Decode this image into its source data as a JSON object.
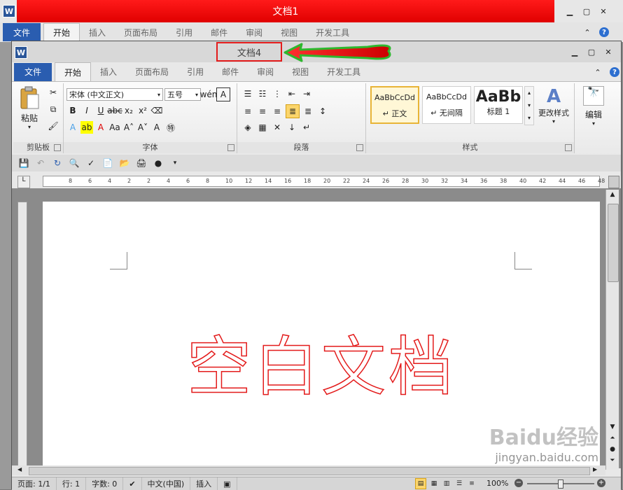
{
  "back_window": {
    "title": "文档1",
    "logo": "W",
    "tabs": [
      "文件",
      "开始",
      "插入",
      "页面布局",
      "引用",
      "邮件",
      "审阅",
      "视图",
      "开发工具"
    ]
  },
  "front_window": {
    "title": "文档4",
    "logo": "W",
    "tabs": [
      "文件",
      "开始",
      "插入",
      "页面布局",
      "引用",
      "邮件",
      "审阅",
      "视图",
      "开发工具"
    ]
  },
  "ribbon": {
    "clipboard": {
      "label": "剪贴板",
      "paste": "粘贴"
    },
    "font": {
      "label": "字体",
      "font_name": "宋体 (中文正文)",
      "font_size": "五号"
    },
    "paragraph": {
      "label": "段落"
    },
    "styles": {
      "label": "样式",
      "items": [
        {
          "preview": "AaBbCcDd",
          "name": "↵ 正文"
        },
        {
          "preview": "AaBbCcDd",
          "name": "↵ 无间隔"
        },
        {
          "preview": "AaBb",
          "name": "标题 1"
        }
      ],
      "change_styles": "更改样式"
    },
    "edit": {
      "label": "编辑"
    }
  },
  "ruler_ticks": [
    "8",
    "6",
    "4",
    "2",
    "2",
    "4",
    "6",
    "8",
    "10",
    "12",
    "14",
    "16",
    "18",
    "20",
    "22",
    "24",
    "26",
    "28",
    "30",
    "32",
    "34",
    "36",
    "38",
    "40",
    "42",
    "44",
    "46",
    "48"
  ],
  "document": {
    "body_text": "空白文档"
  },
  "status": {
    "page": "页面: 1/1",
    "line": "行: 1",
    "words": "字数: 0",
    "language": "中文(中国)",
    "mode": "插入",
    "zoom": "100%"
  },
  "watermark": {
    "brand": "Baidu经验",
    "url": "jingyan.baidu.com"
  },
  "colors": {
    "accent_red": "#e31b1b",
    "file_tab": "#2a5db0",
    "arrow_green": "#2db82d"
  }
}
